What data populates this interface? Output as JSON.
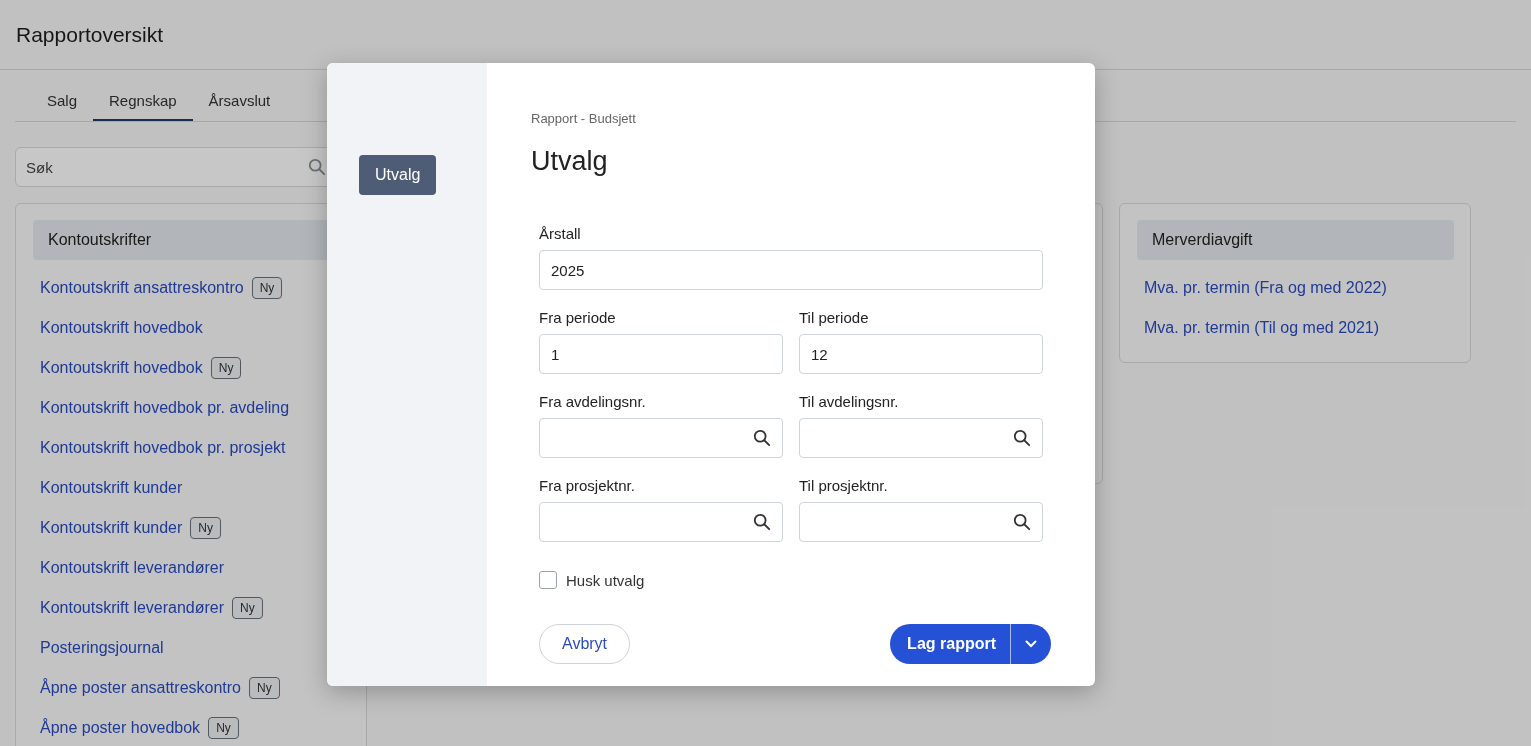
{
  "page": {
    "title": "Rapportoversikt"
  },
  "tabs": [
    {
      "label": "Salg",
      "selected": false
    },
    {
      "label": "Regnskap",
      "selected": true
    },
    {
      "label": "Årsavslut",
      "selected": false
    }
  ],
  "search": {
    "placeholder": "Søk"
  },
  "cards": [
    {
      "heading": "Kontoutskrifter",
      "links": [
        {
          "label": "Kontoutskrift ansattreskontro",
          "badge": "Ny"
        },
        {
          "label": "Kontoutskrift hovedbok"
        },
        {
          "label": "Kontoutskrift hovedbok",
          "badge": "Ny"
        },
        {
          "label": "Kontoutskrift hovedbok pr. avdeling"
        },
        {
          "label": "Kontoutskrift hovedbok pr. prosjekt"
        },
        {
          "label": "Kontoutskrift kunder"
        },
        {
          "label": "Kontoutskrift kunder",
          "badge": "Ny"
        },
        {
          "label": "Kontoutskrift leverandører"
        },
        {
          "label": "Kontoutskrift leverandører",
          "badge": "Ny"
        },
        {
          "label": "Posteringsjournal"
        },
        {
          "label": "Åpne poster ansattreskontro",
          "badge": "Ny"
        },
        {
          "label": "Åpne poster hovedbok",
          "badge": "Ny"
        }
      ]
    },
    {
      "heading": "Merverdiavgift",
      "links": [
        {
          "label": "Mva. pr. termin (Fra og med 2022)"
        },
        {
          "label": "Mva. pr. termin (Til og med 2021)"
        }
      ]
    }
  ],
  "dialog": {
    "nav": [
      {
        "label": "Utvalg",
        "selected": true
      }
    ],
    "breadcrumb": "Rapport - Budsjett",
    "title": "Utvalg",
    "field_rows": [
      [
        {
          "label": "Årstall",
          "value": "2025",
          "kind": "text"
        }
      ],
      [
        {
          "label": "Fra periode",
          "value": "1",
          "kind": "text"
        },
        {
          "label": "Til periode",
          "value": "12",
          "kind": "text"
        }
      ],
      [
        {
          "label": "Fra avdelingsnr.",
          "kind": "lookup"
        },
        {
          "label": "Til avdelingsnr.",
          "kind": "lookup"
        }
      ],
      [
        {
          "label": "Fra prosjektnr.",
          "kind": "lookup"
        },
        {
          "label": "Til prosjektnr.",
          "kind": "lookup"
        }
      ]
    ],
    "remember": {
      "label": "Husk utvalg",
      "checked": false
    },
    "cancel": "Avbryt",
    "submit": "Lag rapport"
  }
}
